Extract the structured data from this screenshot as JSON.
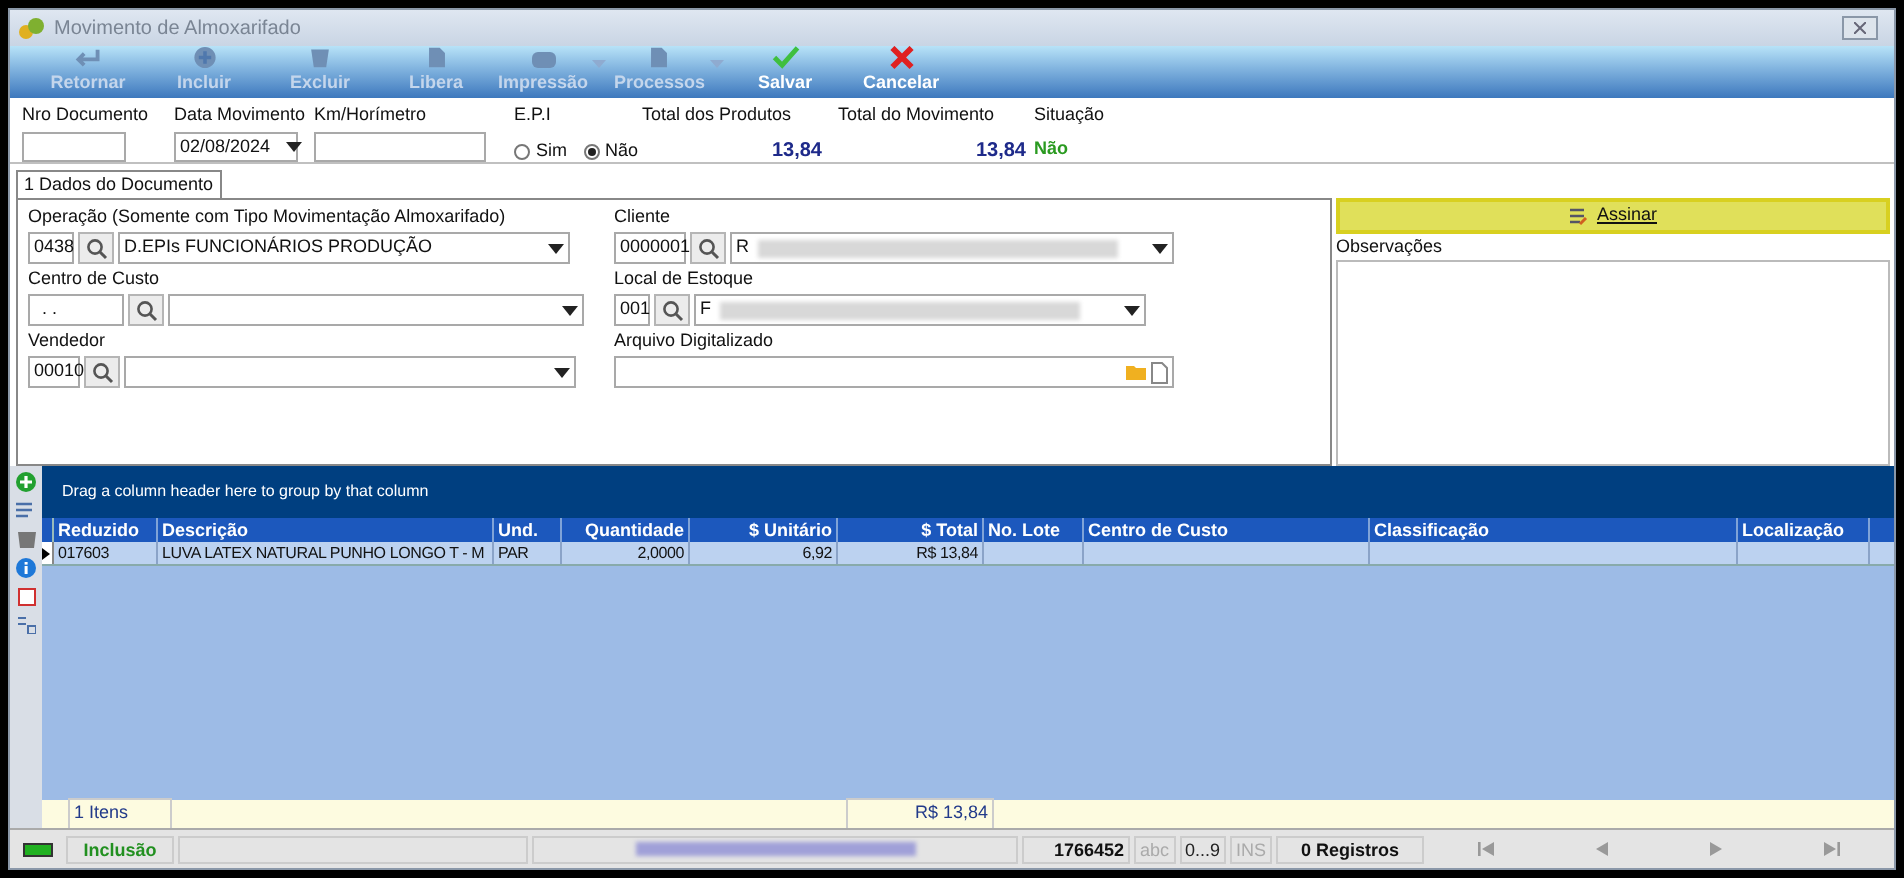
{
  "window": {
    "title": "Movimento de Almoxarifado"
  },
  "toolbar": [
    {
      "label": "Retornar",
      "kind": "back",
      "disabled": true,
      "dropdown": false
    },
    {
      "label": "Incluir",
      "kind": "add",
      "disabled": true,
      "dropdown": false
    },
    {
      "label": "Excluir",
      "kind": "trash",
      "disabled": true,
      "dropdown": false
    },
    {
      "label": "Libera",
      "kind": "doc",
      "disabled": true,
      "dropdown": false
    },
    {
      "label": "Impressão",
      "kind": "print",
      "disabled": true,
      "dropdown": true
    },
    {
      "label": "Processos",
      "kind": "doc",
      "disabled": true,
      "dropdown": true
    },
    {
      "label": "Salvar",
      "kind": "check",
      "disabled": false,
      "dropdown": false
    },
    {
      "label": "Cancelar",
      "kind": "cross",
      "disabled": false,
      "dropdown": false
    }
  ],
  "header": {
    "nro_documento": {
      "label": "Nro Documento"
    },
    "data_movimento": {
      "label": "Data Movimento",
      "value": "02/08/2024"
    },
    "km": {
      "label": "Km/Horímetro"
    },
    "epi": {
      "label": "E.P.I",
      "options": [
        {
          "label": "Sim",
          "selected": false
        },
        {
          "label": "Não",
          "selected": true
        }
      ]
    },
    "total_produtos": {
      "label": "Total dos Produtos",
      "value": "13,84"
    },
    "total_movimento": {
      "label": "Total do Movimento",
      "value": "13,84"
    },
    "situacao": {
      "label": "Situação",
      "value": "Não"
    }
  },
  "tabs": [
    {
      "label": "1 Dados do Documento",
      "selected": true
    }
  ],
  "form": {
    "operacao": {
      "label": "Operação (Somente com Tipo Movimentação Almoxarifado)",
      "code": "0438",
      "value": "D.EPIs FUNCIONÁRIOS PRODUÇÃO"
    },
    "centro_custo": {
      "label": "Centro de Custo",
      "code": ". ."
    },
    "vendedor": {
      "label": "Vendedor",
      "code": "00010"
    },
    "cliente": {
      "label": "Cliente",
      "code": "0000001",
      "value": "R"
    },
    "local_estoque": {
      "label": "Local de Estoque",
      "code": "001",
      "value": "F"
    },
    "arquivo": {
      "label": "Arquivo Digitalizado"
    }
  },
  "sign_button": {
    "label": "Assinar"
  },
  "observacoes": {
    "label": "Observações"
  },
  "grid": {
    "group_hint": "Drag a column header here to group by that column",
    "columns": [
      "Reduzido",
      "Descrição",
      "Und.",
      "Quantidade",
      "$ Unitário",
      "$ Total",
      "No. Lote",
      "Centro de Custo",
      "Classificação",
      "Localização"
    ],
    "rows": [
      [
        "017603",
        "LUVA LATEX NATURAL PUNHO LONGO T - M",
        "PAR",
        "2,0000",
        "6,92",
        "R$ 13,84",
        "",
        "",
        "",
        ""
      ]
    ],
    "footer": {
      "count": "1 Itens",
      "total": "R$ 13,84"
    }
  },
  "status_bar": {
    "mode": "Inclusão",
    "number": "1766452",
    "indicators": [
      {
        "label": "abc",
        "enabled": false
      },
      {
        "label": "0...9",
        "enabled": true
      },
      {
        "label": "INS",
        "enabled": false
      }
    ],
    "records": "0 Registros"
  }
}
